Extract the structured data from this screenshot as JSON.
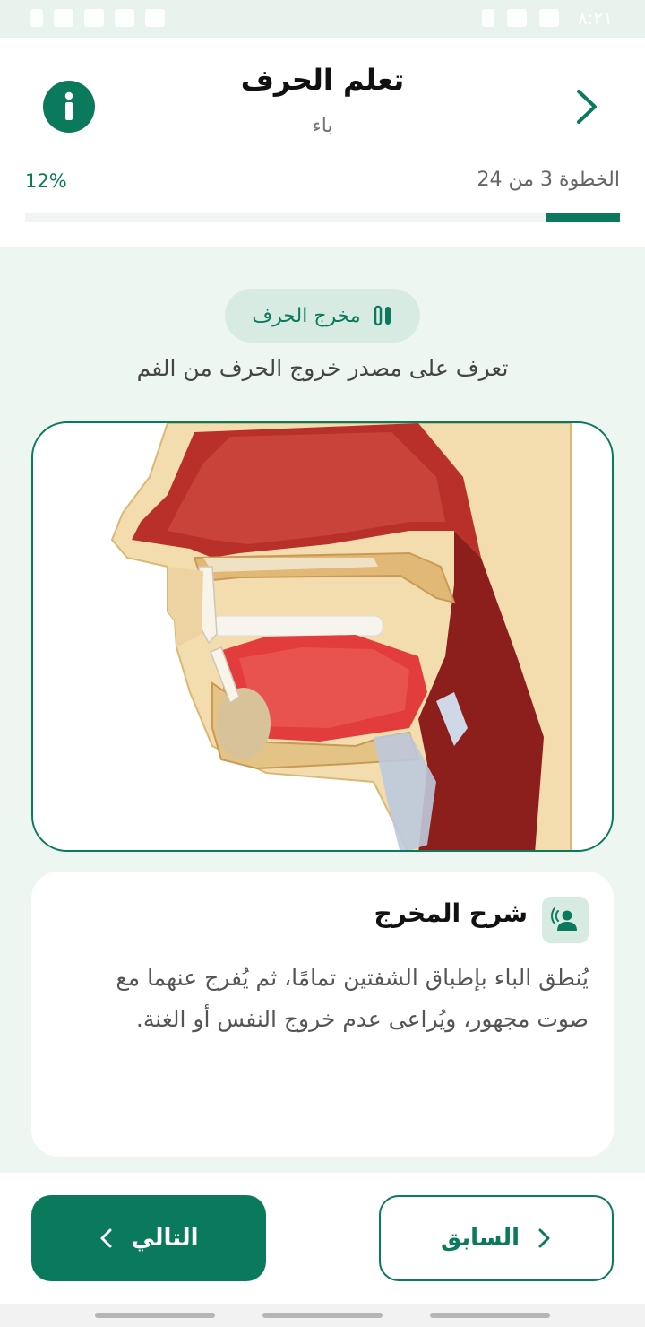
{
  "status_bar": {
    "time": "٨:٢١"
  },
  "header": {
    "title": "تعلم الحرف",
    "subtitle": "باء",
    "step_text": "الخطوة 3 من 24",
    "percent_text": "12%",
    "progress": 0.125,
    "info_icon": "info-icon",
    "back_icon": "chevron-right-icon"
  },
  "section": {
    "pill_label": "مخرج الحرف",
    "pill_icon": "lips-icon",
    "description": "تعرف على مصدر خروج الحرف من الفم"
  },
  "image": {
    "semantic": "mouth-anatomy-cross-section"
  },
  "explanation": {
    "icon": "speaking-person-icon",
    "title": "شرح المخرج",
    "body": "يُنطق الباء بإطباق الشفتين تمامًا، ثم يُفرج عنهما مع صوت مجهور، ويُراعى عدم خروج النفس أو الغنة."
  },
  "footer": {
    "next_label": "التالي",
    "prev_label": "السابق"
  },
  "colors": {
    "accent": "#0b7a5c",
    "accent_light": "#d8ebe3",
    "background": "#eef6f2"
  }
}
